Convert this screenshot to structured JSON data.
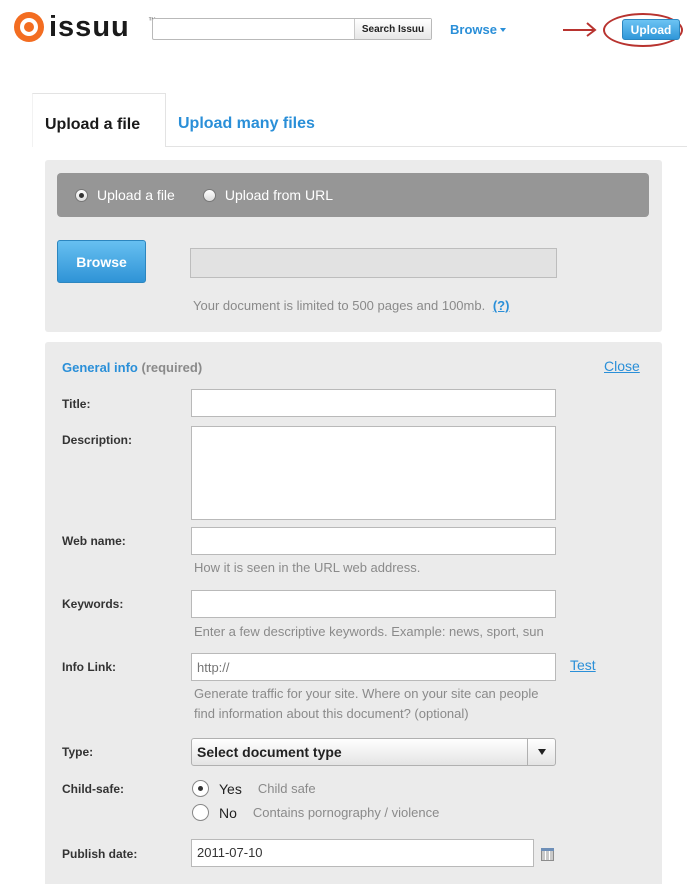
{
  "header": {
    "logo_text": "issuu",
    "logo_tm": "™",
    "search": {
      "value": "",
      "button_label": "Search Issuu"
    },
    "browse_label": "Browse",
    "upload_label": "Upload",
    "annotation_color": "#b8332f"
  },
  "tabs": [
    {
      "label": "Upload a file",
      "active": true
    },
    {
      "label": "Upload many files",
      "active": false
    }
  ],
  "upload_panel": {
    "sources": [
      {
        "label": "Upload a file",
        "selected": true
      },
      {
        "label": "Upload from URL",
        "selected": false
      }
    ],
    "browse_label": "Browse",
    "file_path_value": "",
    "limit_text": "Your document is limited to 500 pages and 100mb.",
    "help_link": "(?)"
  },
  "general_info": {
    "heading": "General info",
    "required": "(required)",
    "close_label": "Close",
    "fields": {
      "title": {
        "label": "Title:",
        "value": ""
      },
      "description": {
        "label": "Description:",
        "value": ""
      },
      "web_name": {
        "label": "Web name:",
        "value": "",
        "hint": "How it is seen in the URL web address."
      },
      "keywords": {
        "label": "Keywords:",
        "value": "",
        "hint": "Enter a few descriptive keywords. Example: news, sport, sun"
      },
      "info_link": {
        "label": "Info Link:",
        "placeholder": "http://",
        "test_label": "Test",
        "hint_line1": "Generate traffic for your site. Where on your site can people",
        "hint_line2": "find information about this document? (optional)"
      },
      "type": {
        "label": "Type:",
        "selected": "Select document type"
      },
      "child_safe": {
        "label": "Child-safe:",
        "options": [
          {
            "label": "Yes",
            "desc": "Child safe",
            "selected": true
          },
          {
            "label": "No",
            "desc": "Contains pornography / violence",
            "selected": false
          }
        ]
      },
      "publish_date": {
        "label": "Publish date:",
        "value": "2011-07-10"
      }
    }
  },
  "colors": {
    "accent": "#2a8fd8",
    "panel": "#ebebeb",
    "brand_orange": "#f36d21"
  }
}
